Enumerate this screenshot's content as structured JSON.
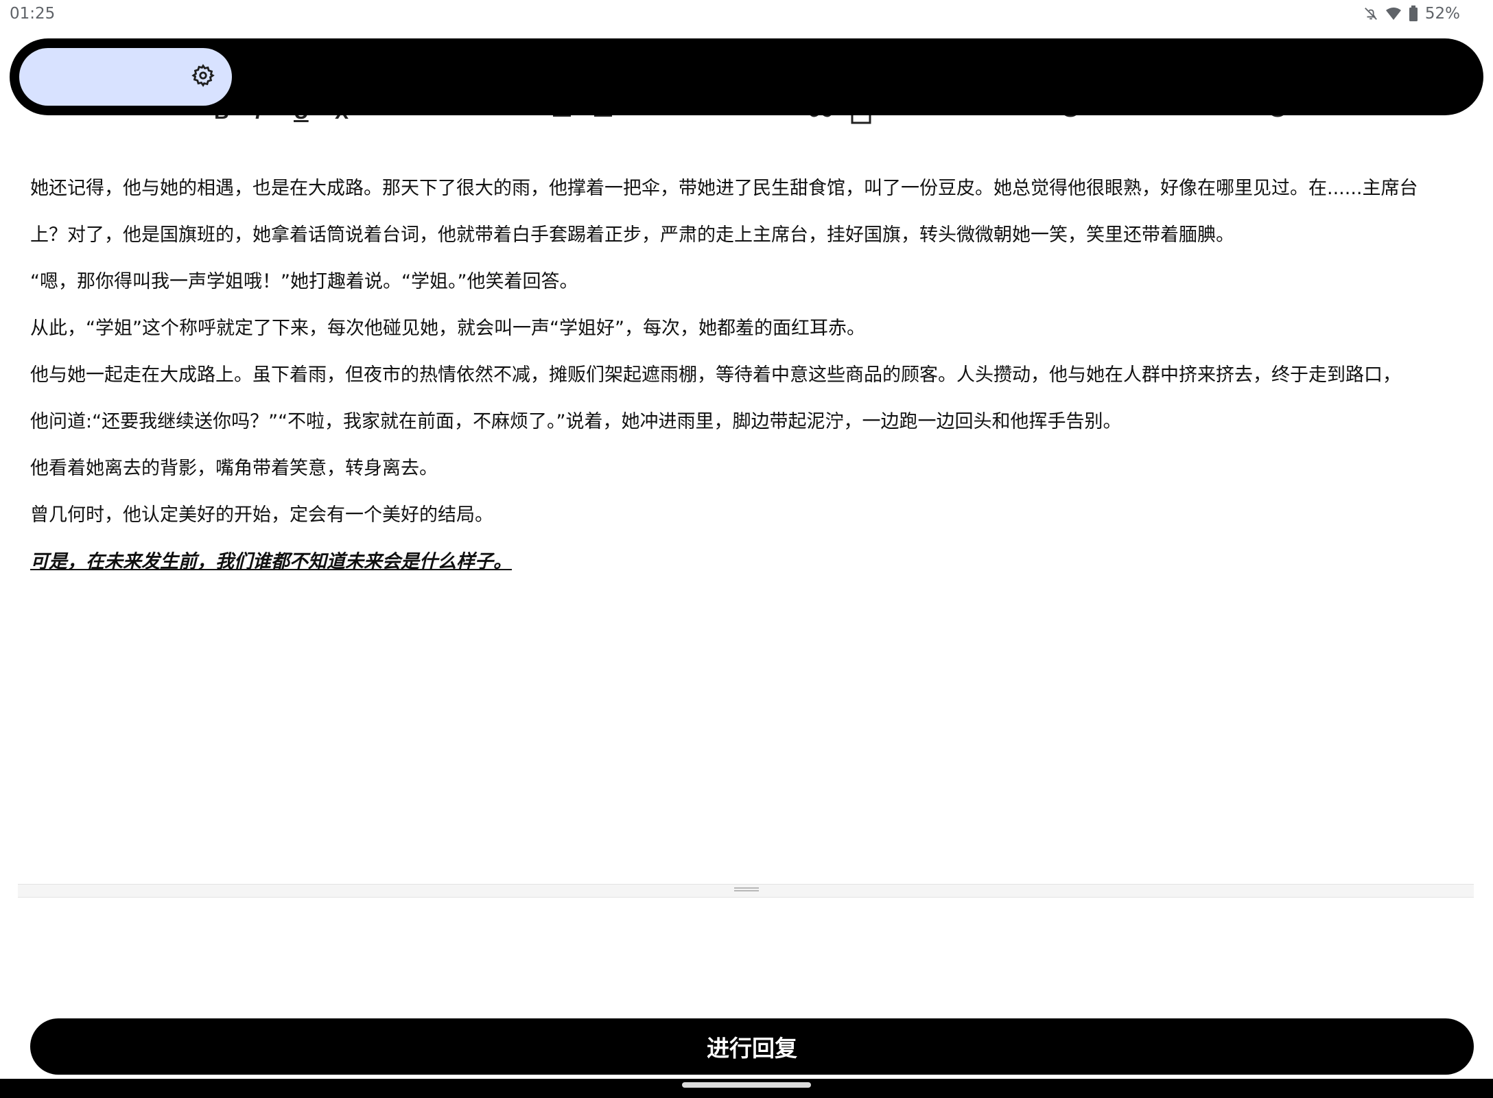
{
  "status_bar": {
    "time": "01:25",
    "battery": "52%"
  },
  "editor": {
    "lines": [
      "她还记得，他与她的相遇，也是在大成路。那天下了很大的雨，他撑着一把伞，带她进了民生甜食馆，叫了一份豆皮。她总觉得他很眼熟，好像在哪里见过。在......主席台",
      "上？对了，他是国旗班的，她拿着话筒说着台词，他就带着白手套踢着正步，严肃的走上主席台，挂好国旗，转头微微朝她一笑，笑里还带着腼腆。",
      "“嗯，那你得叫我一声学姐哦！”她打趣着说。“学姐。”他笑着回答。",
      "从此，“学姐”这个称呼就定了下来，每次他碰见她，就会叫一声“学姐好”，每次，她都羞的面红耳赤。",
      "他与她一起走在大成路上。虽下着雨，但夜市的热情依然不减，摊贩们架起遮雨棚，等待着中意这些商品的顾客。人头攒动，他与她在人群中挤来挤去，终于走到路口，",
      "他问道:“还要我继续送你吗？”“不啦，我家就在前面，不麻烦了。”说着，她冲进雨里，脚边带起泥泞，一边跑一边回头和他挥手告别。",
      "他看着她离去的背影，嘴角带着笑意，转身离去。",
      "曾几何时，他认定美好的开始，定会有一个美好的结局。"
    ],
    "emphasis_line": "可是，在未来发生前，我们谁都不知道未来会是什么样子。"
  },
  "reply_button": {
    "label": "进行回复"
  },
  "icons": {
    "settings": "gear-icon",
    "bell_off": "bell-off-icon",
    "wifi": "wifi-icon",
    "battery": "battery-icon"
  },
  "colors": {
    "overlay": "#000000",
    "chip": "#d8e2ff",
    "button": "#000000",
    "button_text": "#ffffff"
  }
}
